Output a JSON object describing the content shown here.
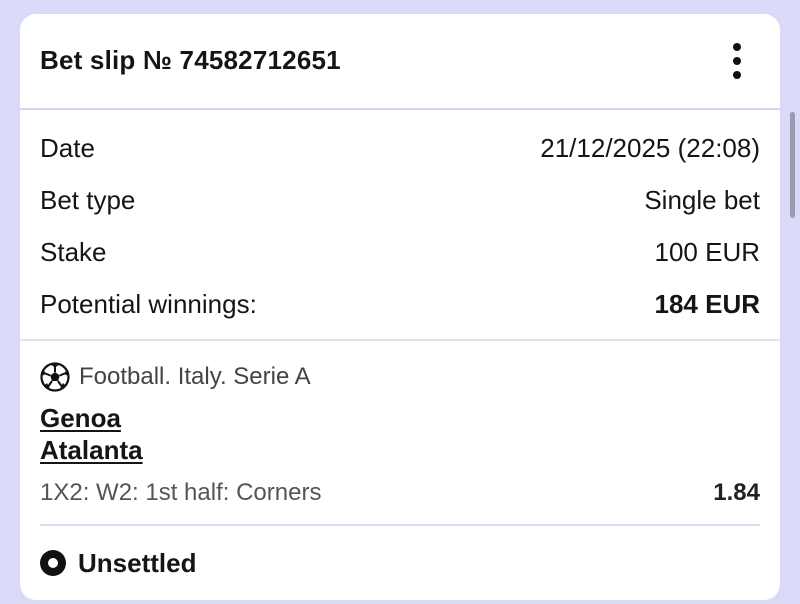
{
  "header": {
    "title": "Bet slip № 74582712651",
    "menu_icon": "more-vertical-icon"
  },
  "details": [
    {
      "label": "Date",
      "value": "21/12/2025 (22:08)"
    },
    {
      "label": "Bet type",
      "value": "Single bet"
    },
    {
      "label": "Stake",
      "value": "100 EUR"
    },
    {
      "label": "Potential winnings:",
      "value": "184 EUR"
    }
  ],
  "event": {
    "sport_icon": "football-icon",
    "league": "Football. Italy. Serie A",
    "team_home": "Genoa",
    "team_away": "Atalanta",
    "market": "1X2: W2: 1st half: Corners",
    "odds": "1.84"
  },
  "status": {
    "icon": "status-dot-icon",
    "label": "Unsettled"
  },
  "colors": {
    "background": "#d9daf7",
    "card": "#ffffff",
    "divider": "#d4d6ef"
  }
}
